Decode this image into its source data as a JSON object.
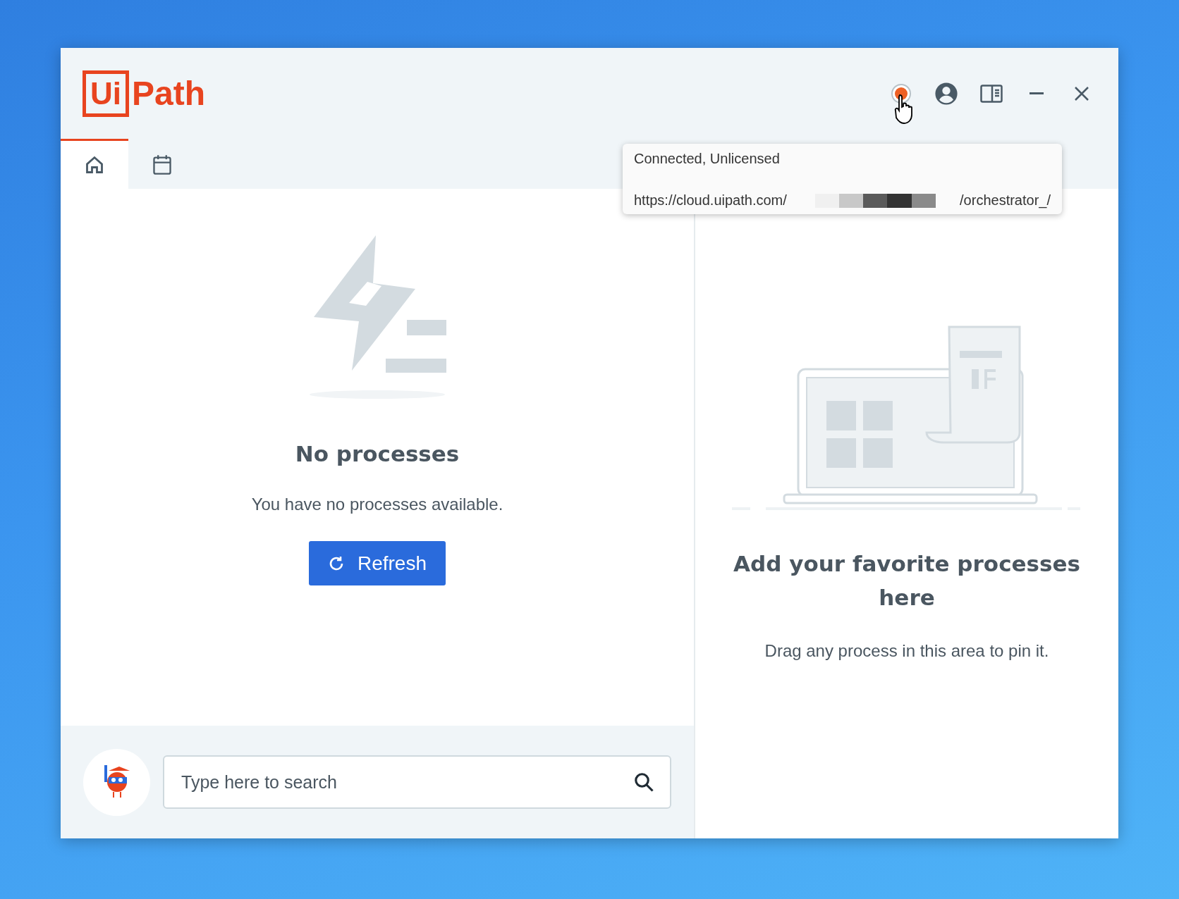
{
  "logo": {
    "box_text": "Ui",
    "text": "Path"
  },
  "tabs": [
    {
      "kind": "home",
      "selected": true
    },
    {
      "kind": "calendar",
      "selected": false
    }
  ],
  "tooltip": {
    "status": "Connected, Unlicensed",
    "url_start": "https://cloud.uipath.com/",
    "url_end": "/orchestrator_/"
  },
  "processes": {
    "title": "No processes",
    "message": "You have no processes available.",
    "button": "Refresh"
  },
  "favorites": {
    "title": "Add your favorite processes here",
    "message": "Drag any process in this area to pin it."
  },
  "search": {
    "placeholder": "Type here to search"
  }
}
